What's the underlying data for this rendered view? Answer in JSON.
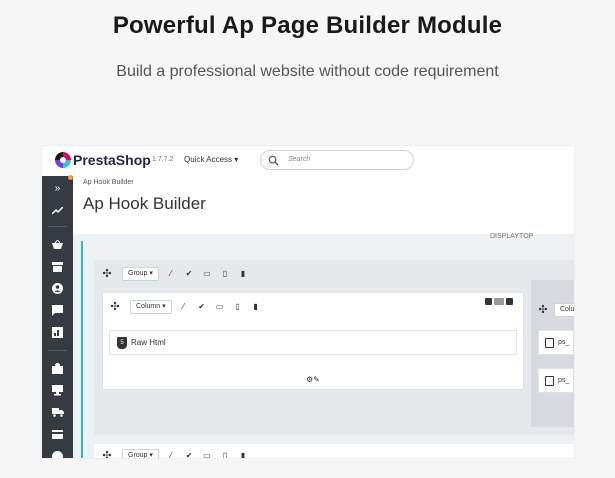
{
  "hero": {
    "title": "Powerful Ap Page Builder Module",
    "subtitle": "Build a professional website without code requirement"
  },
  "topbar": {
    "brand": "PrestaShop",
    "version": "1.7.7.2",
    "quick_access": "Quick Access ▾",
    "search_placeholder": "Search"
  },
  "header": {
    "breadcrumb": "Ap Hook Builder",
    "title": "Ap Hook Builder",
    "hook_label": "DISPLAYTOP"
  },
  "group": {
    "select_label": "Group ▾"
  },
  "column": {
    "select_label": "Column ▾"
  },
  "widget": {
    "label": "Raw Html",
    "badge": "5"
  },
  "side": {
    "select_label": "Colu",
    "items": [
      "ps_",
      "ps_"
    ]
  },
  "bottom": {
    "select_label": "Group ▾"
  },
  "colors": {
    "sidebar": "#363a41",
    "accent": "#25b9d7",
    "brand_pink": "#df0067"
  },
  "icons": {
    "move": "move-icon",
    "wand": "magic-wand-icon",
    "check": "check-icon",
    "desktop": "desktop-icon",
    "tablet": "tablet-icon",
    "mobile": "mobile-icon"
  }
}
